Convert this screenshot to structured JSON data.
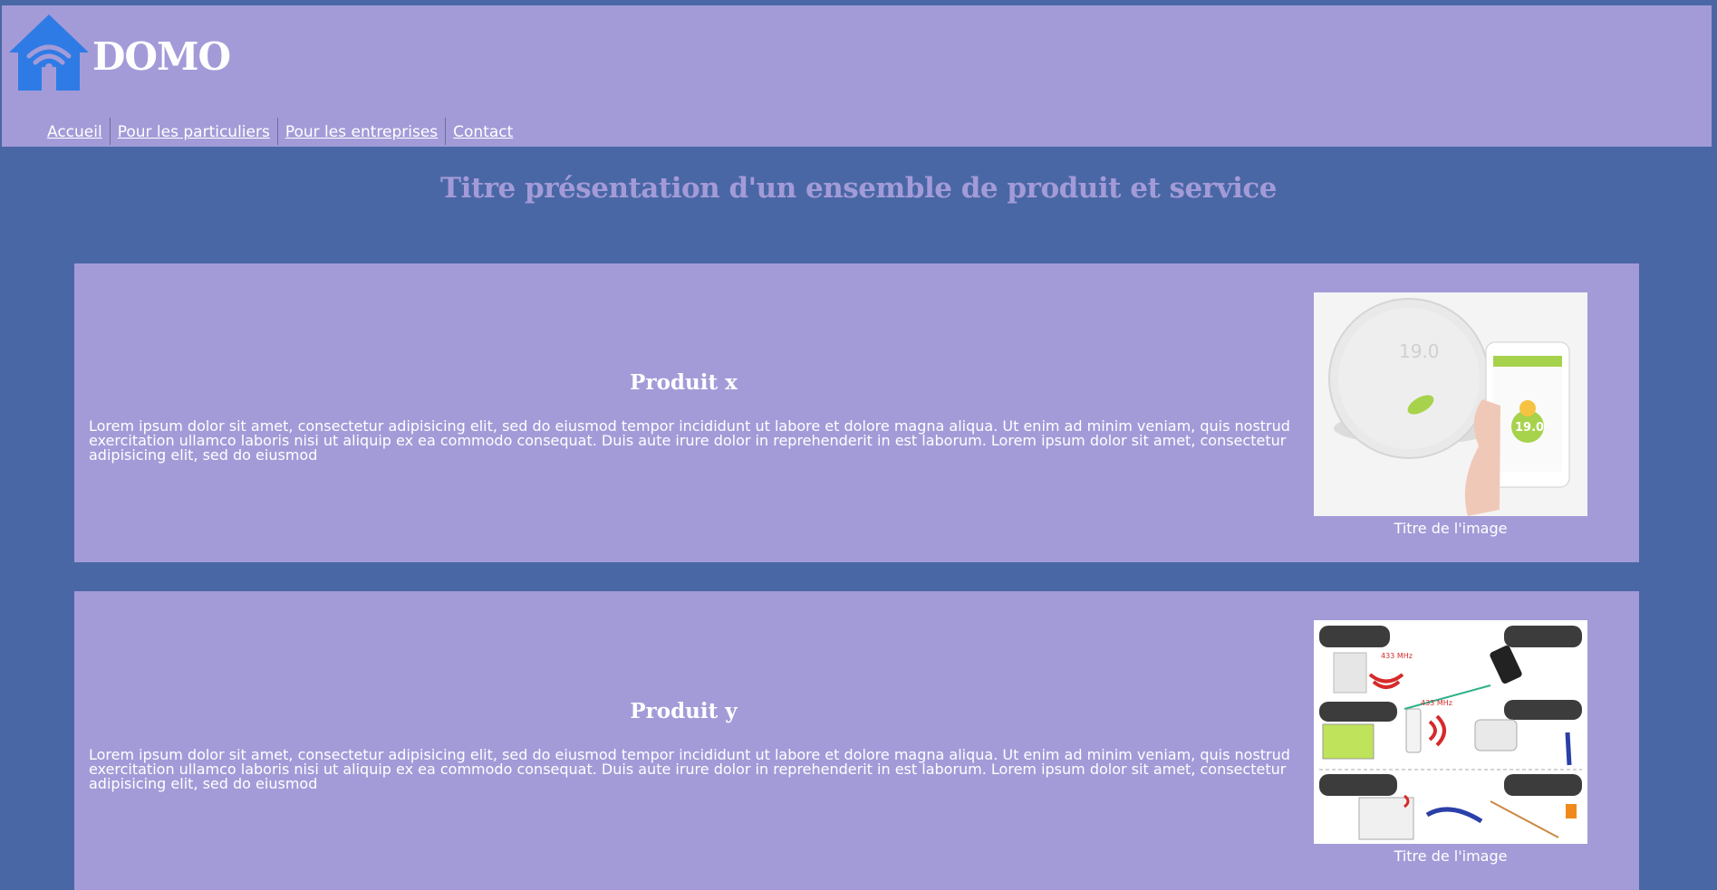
{
  "header": {
    "brand": "DOMO",
    "nav": [
      "Accueil",
      "Pour les particuliers",
      "Pour les entreprises",
      "Contact"
    ]
  },
  "main": {
    "title": "Titre présentation d'un ensemble de produit et service",
    "products": [
      {
        "title": "Produit x",
        "text": "Lorem ipsum dolor sit amet, consectetur adipisicing elit, sed do eiusmod tempor incididunt ut labore et dolore magna aliqua. Ut enim ad minim veniam, quis nostrud exercitation ullamco laboris nisi ut aliquip ex ea commodo consequat. Duis aute irure dolor in reprehenderit in est laborum. Lorem ipsum dolor sit amet, consectetur adipisicing elit, sed do eiusmod",
        "image_caption": "Titre de l'image",
        "thermostat_reading": "19.0",
        "phone_reading": "19.0°"
      },
      {
        "title": "Produit y",
        "text": "Lorem ipsum dolor sit amet, consectetur adipisicing elit, sed do eiusmod tempor incididunt ut labore et dolore magna aliqua. Ut enim ad minim veniam, quis nostrud exercitation ullamco laboris nisi ut aliquip ex ea commodo consequat. Duis aute irure dolor in reprehenderit in est laborum. Lorem ipsum dolor sit amet, consectetur adipisicing elit, sed do eiusmod",
        "image_caption": "Titre de l'image",
        "freq_label_1": "433 MHz",
        "freq_label_2": "433 MHz"
      }
    ]
  },
  "colors": {
    "page_bg": "#4a67a5",
    "panel_bg": "#a39bd8",
    "logo_blue": "#2f7be6",
    "text_white": "#ffffff"
  },
  "icons": {
    "logo": "house-wifi-icon"
  }
}
